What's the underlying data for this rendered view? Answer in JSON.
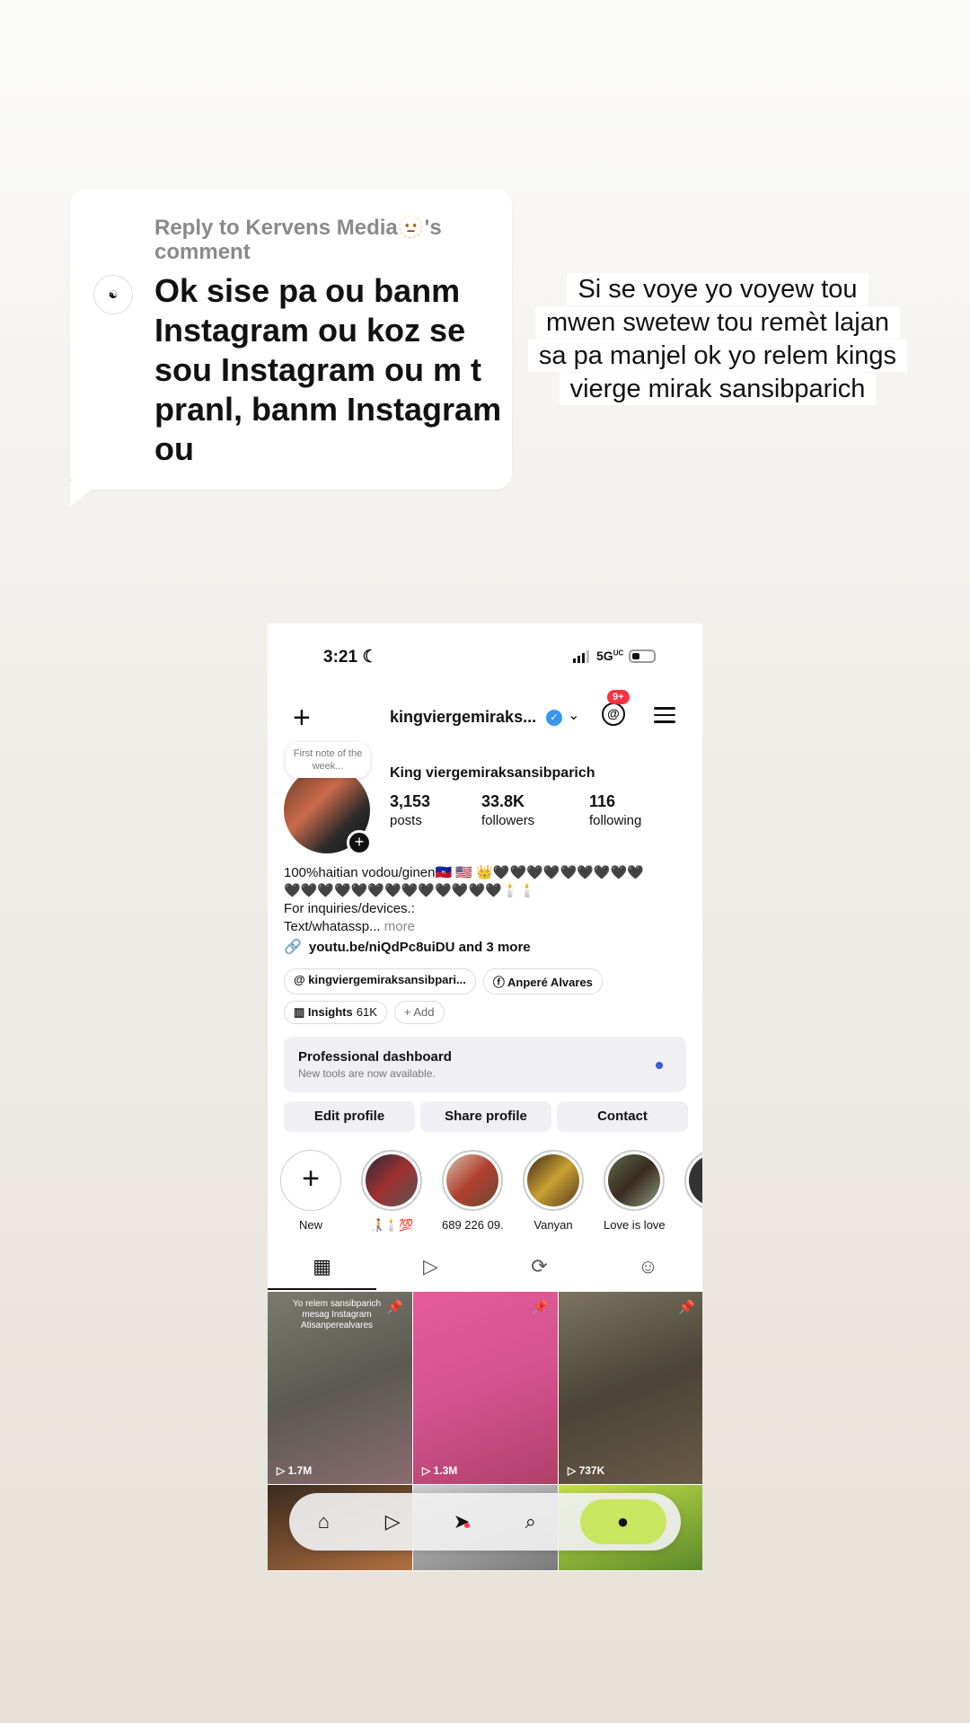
{
  "reply": {
    "header": "Reply to Kervens Media🫥's comment",
    "body": "Ok sise pa ou banm Instagram ou koz se sou Instagram ou m t pranl, banm Instagram ou",
    "avatar_text": "☯"
  },
  "caption": {
    "lines": [
      "Si se voye yo voyew tou",
      "mwen swetew tou remèt lajan",
      "sa pa manjel ok yo relem kings",
      "vierge mirak sansibparich"
    ]
  },
  "phone": {
    "status": {
      "time": "3:21",
      "moon": "☾",
      "network": "5G",
      "network_sup": "UC"
    },
    "nav": {
      "username": "kingviergemiraks...",
      "badge": "9+"
    },
    "note": "First note of the week...",
    "profile": {
      "display_name": "King viergemiraksansibparich",
      "stats": [
        {
          "num": "3,153",
          "label": "posts"
        },
        {
          "num": "33.8K",
          "label": "followers"
        },
        {
          "num": "116",
          "label": "following"
        }
      ],
      "bio_line1": "100%haitian vodou/ginen🇭🇹 🇺🇸 👑🖤🖤🖤🖤🖤🖤🖤🖤🖤",
      "bio_line2": "🖤🖤🖤🖤🖤🖤🖤🖤🖤🖤🖤🖤🖤🕯️🕯️",
      "bio_line3": "For inquiries/devices.:",
      "bio_line4": "Text/whatassp...",
      "bio_more": "more",
      "link": "youtu.be/niQdPc8uiDU and 3 more",
      "chip_threads": "kingviergemiraksansibpari...",
      "chip_fb": "Anperé Alvares",
      "chip_insights": "Insights",
      "chip_insights_count": "61K",
      "chip_add": "Add"
    },
    "dashboard": {
      "title": "Professional dashboard",
      "subtitle": "New tools are now available."
    },
    "actions": [
      "Edit profile",
      "Share profile",
      "Contact"
    ],
    "highlights": [
      "New",
      "🧑‍🦯🕯️💯",
      "689 226 09...",
      "Vanyan",
      "Love is love",
      "🎶"
    ],
    "grid": [
      {
        "views": "1.7M",
        "overlay": "Yo relem sansibparich mesag Instagram Atisanperealvares"
      },
      {
        "views": "1.3M",
        "overlay": ""
      },
      {
        "views": "737K",
        "overlay": ""
      }
    ]
  }
}
